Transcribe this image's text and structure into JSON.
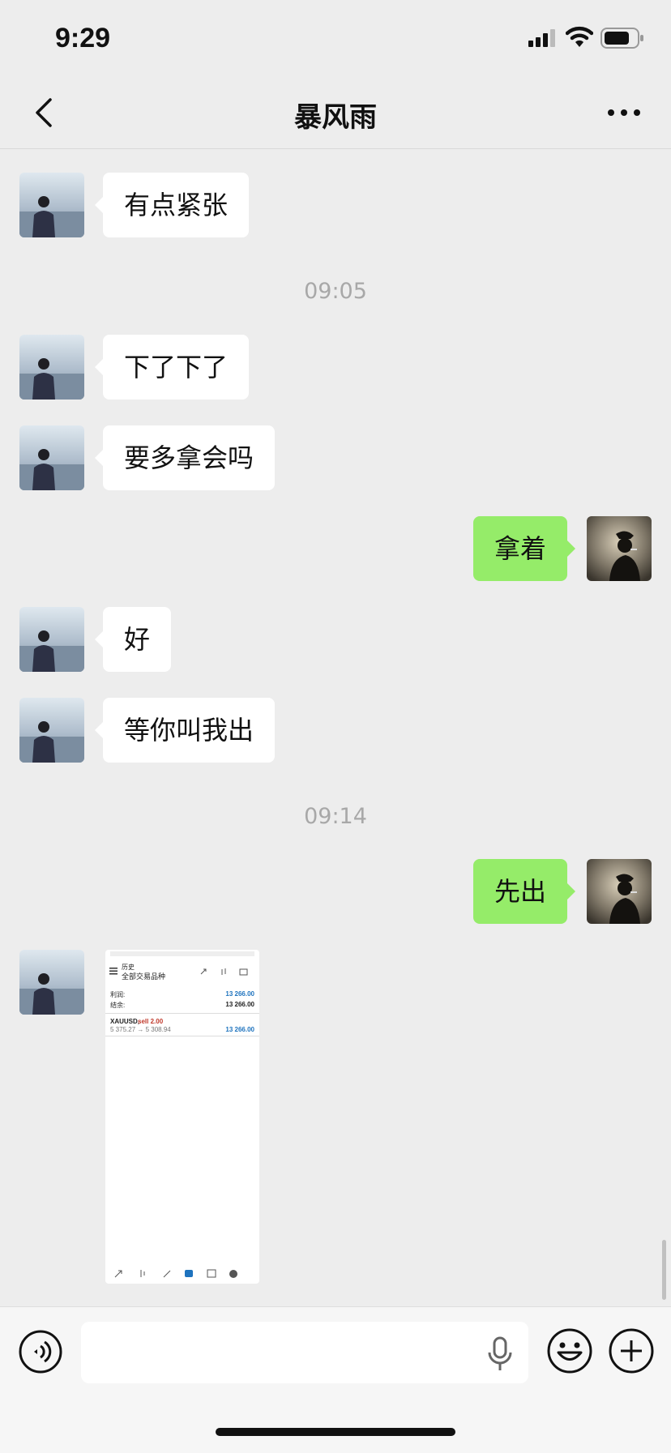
{
  "status": {
    "time": "9:29"
  },
  "header": {
    "title": "暴风雨"
  },
  "messages": {
    "m1": "有点紧张",
    "ts1": "09:05",
    "m2": "下了下了",
    "m3": "要多拿会吗",
    "m4": "拿着",
    "m5": "好",
    "m6": "等你叫我出",
    "ts2": "09:14",
    "m7": "先出"
  },
  "screenshot": {
    "title_line1": "历史",
    "title_line2": "全部交易品种",
    "profit_label": "利润:",
    "profit_value": "13 266.00",
    "balance_label": "结余:",
    "balance_value": "13 266.00",
    "symbol": "XAUUSD,",
    "order": "sell 2.00",
    "prices": "5 375.27 → 5 308.94",
    "trade_profit": "13 266.00",
    "accent": "#1e73be",
    "sell_color": "#c0392b"
  },
  "colors": {
    "outgoing_bubble": "#95ec69",
    "incoming_bubble": "#ffffff",
    "background": "#ededed"
  },
  "icons": [
    "back-icon",
    "more-icon",
    "voice-icon",
    "mic-icon",
    "emoji-icon",
    "plus-icon"
  ]
}
